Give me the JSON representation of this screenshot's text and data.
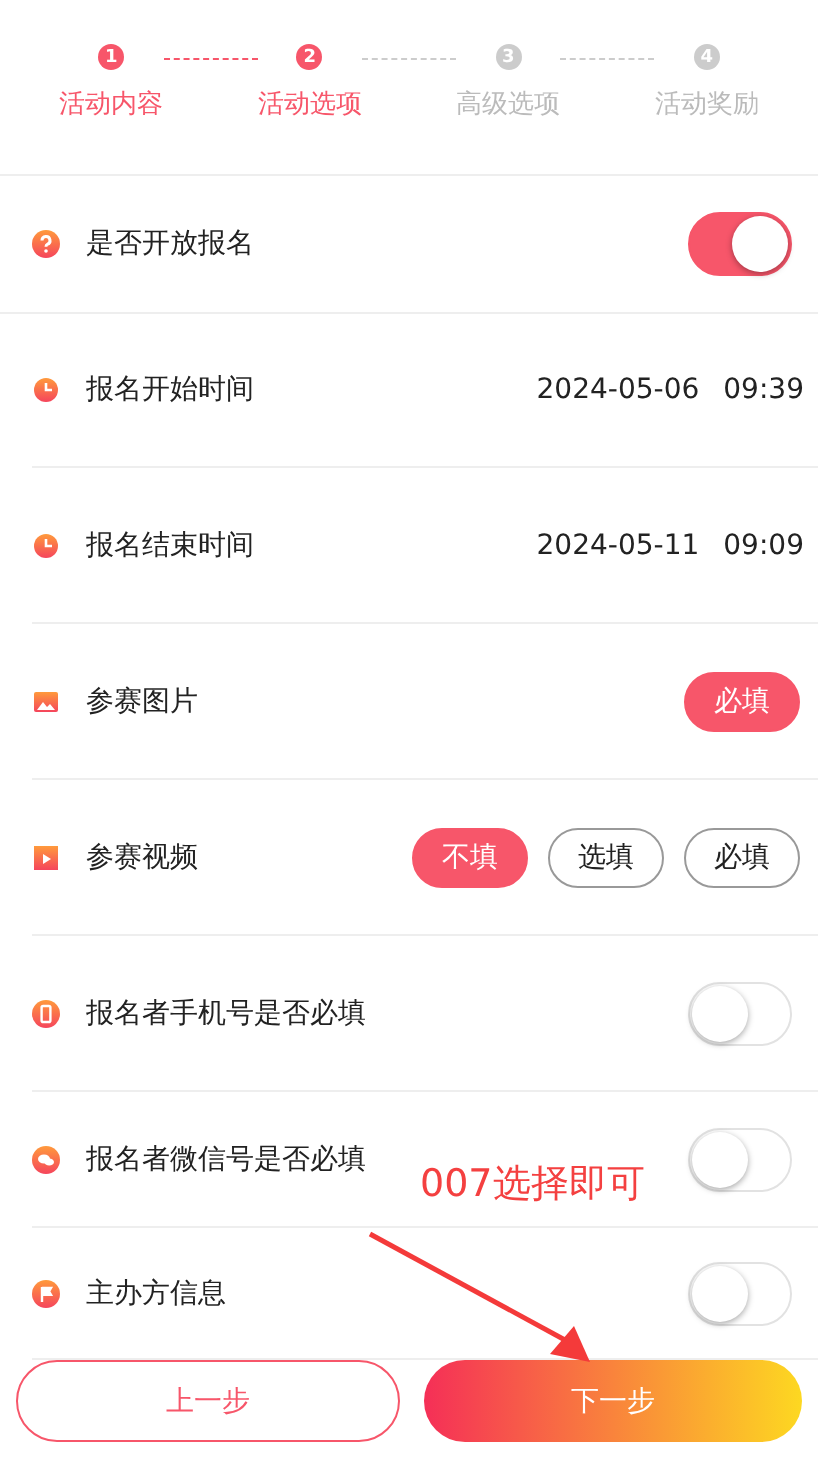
{
  "steps": [
    {
      "number": "1",
      "label": "活动内容",
      "active": true
    },
    {
      "number": "2",
      "label": "活动选项",
      "active": true
    },
    {
      "number": "3",
      "label": "高级选项",
      "active": false
    },
    {
      "number": "4",
      "label": "活动奖励",
      "active": false
    }
  ],
  "rows": [
    {
      "kind": "toggle",
      "label": "是否开放报名",
      "on": true
    },
    {
      "kind": "datetime",
      "label": "报名开始时间",
      "date": "2024-05-06",
      "time": "09:39"
    },
    {
      "kind": "datetime",
      "label": "报名结束时间",
      "date": "2024-05-11",
      "time": "09:09"
    },
    {
      "kind": "options",
      "label": "参赛图片",
      "options": [
        {
          "label": "必填",
          "selected": true
        }
      ]
    },
    {
      "kind": "options",
      "label": "参赛视频",
      "options": [
        {
          "label": "不填",
          "selected": true
        },
        {
          "label": "选填",
          "selected": false
        },
        {
          "label": "必填",
          "selected": false
        }
      ]
    },
    {
      "kind": "toggle",
      "label": "报名者手机号是否必填",
      "on": false
    },
    {
      "kind": "toggle",
      "label": "报名者微信号是否必填",
      "on": false
    },
    {
      "kind": "toggle",
      "label": "主办方信息",
      "on": false
    }
  ],
  "annotation": {
    "text": "007选择即可"
  },
  "footer": {
    "prev": "上一步",
    "next": "下一步"
  }
}
